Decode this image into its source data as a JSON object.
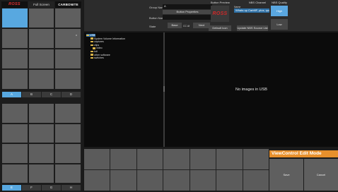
{
  "topbar": {
    "logo": "ROSS",
    "tab_full_screen": "Full Screen",
    "product": "CARBONITE"
  },
  "top_grid": {
    "cells": 12,
    "selected_index": 0,
    "pages": [
      "A",
      "B",
      "C",
      "D"
    ],
    "active_page": 0
  },
  "bottom_grid": {
    "cells": 12,
    "pages": [
      "E",
      "F",
      "G",
      "H"
    ],
    "active_page": 0
  },
  "settings": {
    "group_name_label": "Group Name",
    "group_name_value": "A",
    "button_properties_label": "Button Properties",
    "button_name_label": "Button Name",
    "button_name_value": "",
    "state_label": "State",
    "base_label": "Base",
    "cc_label": "CC Af",
    "next_label": "Next",
    "button_preview_title": "Button Preview",
    "button_preview_logo": "ROSS",
    "default_icon_label": "Default Icon",
    "nbs_title": "NBS Channel",
    "name_label": "Name",
    "nbs_value": "Whats up Carb5F, plus, quality, a",
    "update_label": "Update NBS Source List",
    "nbs_quality_title": "NBS Quality",
    "quality_high": "High",
    "quality_low": "Low"
  },
  "tree": {
    "close_glyph": "x",
    "items": [
      {
        "label": "USB",
        "indent": 0,
        "selected": true
      },
      {
        "label": "System Volume Information",
        "indent": 2
      },
      {
        "label": "captures",
        "indent": 2
      },
      {
        "label": "clips",
        "indent": 2
      },
      {
        "label": "video",
        "indent": 3
      },
      {
        "label": "bdl",
        "indent": 2
      },
      {
        "label": "other software",
        "indent": 2
      },
      {
        "label": "switches",
        "indent": 2
      }
    ]
  },
  "preview": {
    "empty_message": "No images in USB"
  },
  "edit_mode": {
    "title": "ViewControl Edit Mode",
    "save_label": "Save",
    "cancel_label": "Cancel"
  },
  "colors": {
    "accent": "#58a8e0",
    "edit_mode_bar": "#e8902c",
    "logo_red": "#d02828"
  }
}
